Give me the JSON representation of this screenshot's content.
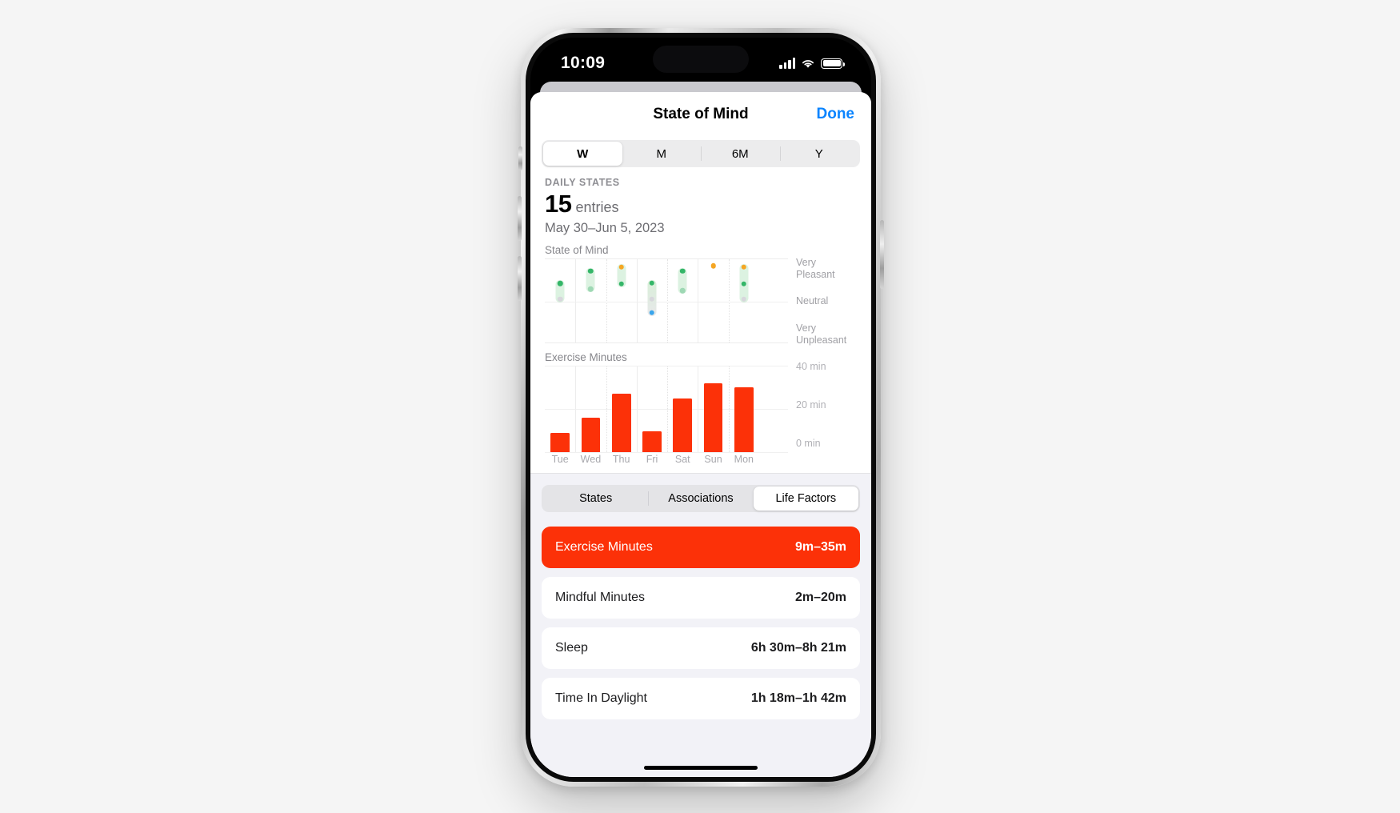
{
  "status_bar": {
    "time": "10:09",
    "cellular_icon": "signal-bars-icon",
    "wifi_icon": "wifi-icon",
    "battery_icon": "battery-full-icon"
  },
  "nav": {
    "title": "State of Mind",
    "done_label": "Done",
    "done_color": "#0a84ff"
  },
  "range_selector": {
    "options": [
      {
        "label": "W",
        "active": true
      },
      {
        "label": "M",
        "active": false
      },
      {
        "label": "6M",
        "active": false
      },
      {
        "label": "Y",
        "active": false
      }
    ]
  },
  "summary": {
    "label": "DAILY STATES",
    "value": "15",
    "unit": "entries",
    "date_range": "May 30–Jun 5, 2023"
  },
  "factor_tabs": {
    "options": [
      {
        "label": "States",
        "active": false
      },
      {
        "label": "Associations",
        "active": false
      },
      {
        "label": "Life Factors",
        "active": true
      }
    ]
  },
  "life_factors": [
    {
      "name": "Exercise Minutes",
      "value": "9m–35m",
      "selected": true
    },
    {
      "name": "Mindful Minutes",
      "value": "2m–20m",
      "selected": false
    },
    {
      "name": "Sleep",
      "value": "6h 30m–8h 21m",
      "selected": false
    },
    {
      "name": "Time In Daylight",
      "value": "1h 18m–1h 42m",
      "selected": false
    }
  ],
  "accent_colors": {
    "exercise_red": "#fc3108",
    "done_blue": "#0a84ff",
    "pleasant_green": "#34b668",
    "very_pleasant_orange": "#f5a623",
    "unpleasant_blue": "#3aa5ec",
    "neutral_gray": "#c7c7cc"
  },
  "chart_data": [
    {
      "type": "scatter",
      "title": "State of Mind",
      "xlabel": "",
      "ylabel": "",
      "ylim": [
        -1,
        1
      ],
      "grid": true,
      "axis_labels": [
        "Very Pleasant",
        "Neutral",
        "Very Unpleasant"
      ],
      "categories": [
        "Tue",
        "Wed",
        "Thu",
        "Fri",
        "Sat",
        "Sun",
        "Mon"
      ],
      "series": [
        {
          "name": "Daily states",
          "points": [
            {
              "x": "Tue",
              "values": [
                0.43,
                0.06
              ],
              "colors": [
                "#34b668",
                "#d7d7dc"
              ]
            },
            {
              "x": "Wed",
              "values": [
                0.72,
                0.3
              ],
              "colors": [
                "#34b668",
                "#9ed8b4"
              ]
            },
            {
              "x": "Thu",
              "values": [
                0.82,
                0.42
              ],
              "colors": [
                "#f5a623",
                "#34b668"
              ]
            },
            {
              "x": "Fri",
              "values": [
                0.44,
                0.06,
                -0.26
              ],
              "colors": [
                "#34b668",
                "#d7d7dc",
                "#3aa5ec"
              ]
            },
            {
              "x": "Sat",
              "values": [
                0.72,
                0.26
              ],
              "colors": [
                "#34b668",
                "#9ed8b4"
              ]
            },
            {
              "x": "Sun",
              "values": [
                0.84
              ],
              "colors": [
                "#f5a623"
              ]
            },
            {
              "x": "Mon",
              "values": [
                0.82,
                0.42,
                0.06
              ],
              "colors": [
                "#f5a623",
                "#34b668",
                "#d7d7dc"
              ]
            }
          ]
        }
      ]
    },
    {
      "type": "bar",
      "title": "Exercise Minutes",
      "xlabel": "",
      "ylabel": "",
      "ylim": [
        0,
        40
      ],
      "yticks": [
        "0 min",
        "20 min",
        "40 min"
      ],
      "grid": true,
      "categories": [
        "Tue",
        "Wed",
        "Thu",
        "Fri",
        "Sat",
        "Sun",
        "Mon"
      ],
      "values": [
        9,
        16,
        27,
        9.5,
        25,
        32,
        30
      ],
      "bar_color": "#fc3108"
    }
  ]
}
